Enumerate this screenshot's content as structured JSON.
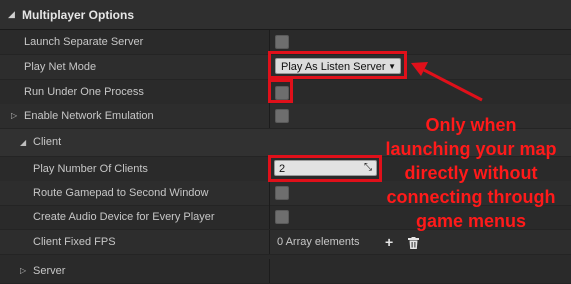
{
  "section": {
    "title": "Multiplayer Options",
    "collapse_glyph": "◢"
  },
  "rows": {
    "launch_separate_server": "Launch Separate Server",
    "play_net_mode": "Play Net Mode",
    "run_under_one_process": "Run Under One Process",
    "enable_network_emulation": "Enable Network Emulation",
    "client": "Client",
    "play_number_of_clients": "Play Number Of Clients",
    "route_gamepad": "Route Gamepad to Second Window",
    "create_audio_device": "Create Audio Device for Every Player",
    "client_fixed_fps": "Client Fixed FPS",
    "server": "Server"
  },
  "values": {
    "play_net_mode": "Play As Listen Server",
    "play_number_of_clients": "2",
    "client_fixed_fps": "0 Array elements"
  },
  "glyphs": {
    "expand": "▷",
    "collapse": "◢",
    "dropdown": "▼",
    "add": "+",
    "delete": "🗑"
  },
  "annotation": {
    "lines": [
      "Only when",
      "launching your map",
      "directly without",
      "connecting through",
      "game menus"
    ],
    "color": "#ff1a1a"
  }
}
